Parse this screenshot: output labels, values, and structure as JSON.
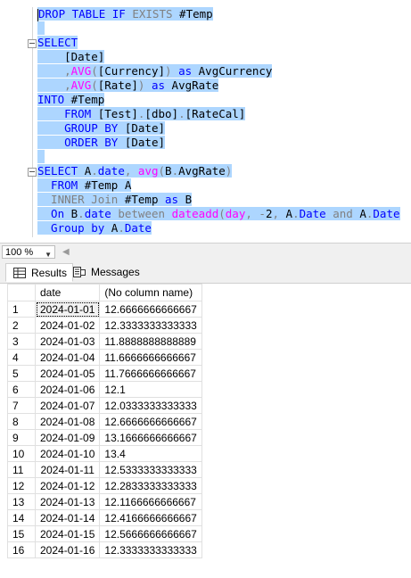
{
  "editor": {
    "lines": {
      "l1": {
        "kw1": "DROP TABLE IF ",
        "gr1": "EXISTS ",
        "tx1": "#Temp"
      },
      "l3": {
        "kw1": "SELECT"
      },
      "l4": {
        "tx1": "    [Date]"
      },
      "l5": {
        "gr1": "    ,",
        "fn1": "AVG",
        "gr2": "(",
        "tx1": "[Currency]",
        "gr3": ") ",
        "kw1": "as ",
        "tx2": "AvgCurrency"
      },
      "l6": {
        "gr1": "    ,",
        "fn1": "AVG",
        "gr2": "(",
        "tx1": "[Rate]",
        "gr3": ") ",
        "kw1": "as ",
        "tx2": "AvgRate"
      },
      "l7": {
        "kw1": "INTO ",
        "tx1": "#Temp"
      },
      "l8": {
        "kw1": "    FROM ",
        "tx1": "[Test]",
        "gr1": ".",
        "tx2": "[dbo]",
        "gr2": ".",
        "tx3": "[RateCal]"
      },
      "l9": {
        "kw1": "    GROUP BY ",
        "tx1": "[Date]"
      },
      "l10": {
        "kw1": "    ORDER BY ",
        "tx1": "[Date]"
      },
      "l12": {
        "kw1": "SELECT ",
        "tx1": "A",
        "gr1": ".",
        "kw2": "date",
        "gr2": ", ",
        "fn1": "avg",
        "gr3": "(",
        "tx2": "B",
        "gr4": ".",
        "tx3": "AvgRate",
        "gr5": ")"
      },
      "l13": {
        "kw1": "  FROM ",
        "tx1": "#Temp A"
      },
      "l14": {
        "gr1": "  INNER Join ",
        "tx1": "#Temp ",
        "kw1": "as ",
        "tx2": "B"
      },
      "l15": {
        "kw1": "  On ",
        "tx1": "B",
        "gr1": ".",
        "kw2": "date ",
        "gr2": "between ",
        "fn1": "dateadd",
        "gr3": "(",
        "fn2": "day",
        "gr4": ", -",
        "tx2": "2",
        "gr5": ", ",
        "tx3": "A",
        "gr6": ".",
        "kw3": "Date ",
        "gr7": "and ",
        "tx4": "A",
        "gr8": ".",
        "kw4": "Date"
      },
      "l16": {
        "kw1": "  Group by ",
        "tx1": "A",
        "gr1": ".",
        "kw2": "Date"
      }
    }
  },
  "zoom": {
    "value": "100 %"
  },
  "tabs": {
    "results": "Results",
    "messages": "Messages"
  },
  "grid": {
    "headers": {
      "rownum": "",
      "date": "date",
      "value": "(No column name)"
    },
    "rows": [
      {
        "n": "1",
        "date": "2024-01-01",
        "value": "12.6666666666667"
      },
      {
        "n": "2",
        "date": "2024-01-02",
        "value": "12.3333333333333"
      },
      {
        "n": "3",
        "date": "2024-01-03",
        "value": "11.8888888888889"
      },
      {
        "n": "4",
        "date": "2024-01-04",
        "value": "11.6666666666667"
      },
      {
        "n": "5",
        "date": "2024-01-05",
        "value": "11.7666666666667"
      },
      {
        "n": "6",
        "date": "2024-01-06",
        "value": "12.1"
      },
      {
        "n": "7",
        "date": "2024-01-07",
        "value": "12.0333333333333"
      },
      {
        "n": "8",
        "date": "2024-01-08",
        "value": "12.6666666666667"
      },
      {
        "n": "9",
        "date": "2024-01-09",
        "value": "13.1666666666667"
      },
      {
        "n": "10",
        "date": "2024-01-10",
        "value": "13.4"
      },
      {
        "n": "11",
        "date": "2024-01-11",
        "value": "12.5333333333333"
      },
      {
        "n": "12",
        "date": "2024-01-12",
        "value": "12.2833333333333"
      },
      {
        "n": "13",
        "date": "2024-01-13",
        "value": "12.1166666666667"
      },
      {
        "n": "14",
        "date": "2024-01-14",
        "value": "12.4166666666667"
      },
      {
        "n": "15",
        "date": "2024-01-15",
        "value": "12.5666666666667"
      },
      {
        "n": "16",
        "date": "2024-01-16",
        "value": "12.3333333333333"
      }
    ]
  },
  "colors": {
    "keyword": "#0000ff",
    "function": "#ff00ff",
    "operator": "#808080",
    "selection": "#add6ff"
  }
}
